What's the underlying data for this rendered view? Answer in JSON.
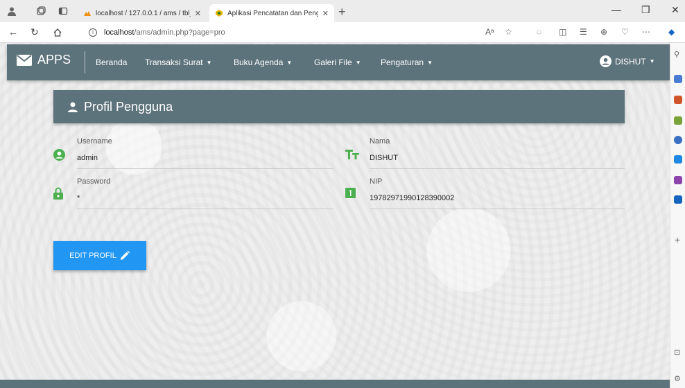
{
  "browser": {
    "tabs": [
      {
        "title": "localhost / 127.0.0.1 / ams / tbl_s",
        "active": false
      },
      {
        "title": "Aplikasi Pencatatan dan Pengarsi",
        "active": true
      }
    ],
    "new_tab": "+",
    "url_host": "localhost",
    "url_path": "/ams/admin.php?page=pro",
    "read_aloud": "Aᵃ"
  },
  "app": {
    "brand": "APPS",
    "nav": [
      {
        "label": "Beranda",
        "has_dropdown": false
      },
      {
        "label": "Transaksi Surat",
        "has_dropdown": true
      },
      {
        "label": "Buku Agenda",
        "has_dropdown": true
      },
      {
        "label": "Galeri File",
        "has_dropdown": true
      },
      {
        "label": "Pengaturan",
        "has_dropdown": true
      }
    ],
    "user": "DISHUT",
    "colors": {
      "navbar": "#5d737b",
      "accent": "#2196f3",
      "icon_green": "#4caf50"
    }
  },
  "profile": {
    "title": "Profil Pengguna",
    "fields": {
      "username": {
        "label": "Username",
        "value": "admin",
        "icon": "account-circle-icon"
      },
      "password": {
        "label": "Password",
        "value": "*",
        "icon": "lock-icon"
      },
      "nama": {
        "label": "Nama",
        "value": "DISHUT",
        "icon": "text-format-icon"
      },
      "nip": {
        "label": "NIP",
        "value": "19782971990128390002",
        "icon": "numeric-one-box-icon"
      }
    },
    "edit_button": "EDIT PROFIL"
  }
}
